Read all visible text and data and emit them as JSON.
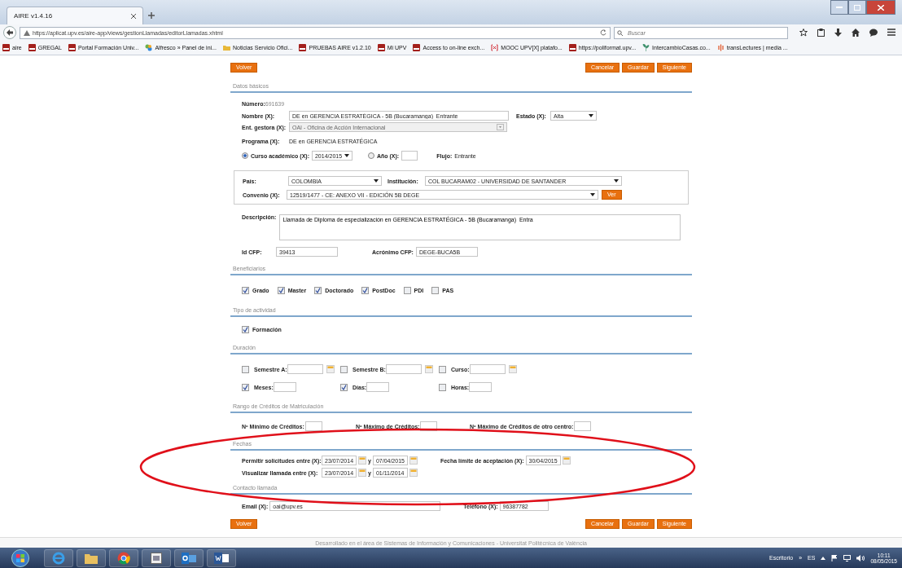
{
  "browser": {
    "tab_title": "AIRE v1.4.16",
    "url": "https://aplicat.upv.es/aire-app/views/gestionLlamadas/editorLlamadas.xhtml",
    "search_placeholder": "Buscar",
    "bookmarks": [
      {
        "kind": "upv",
        "label": "aire"
      },
      {
        "kind": "upv",
        "label": "GREGAL"
      },
      {
        "kind": "upv",
        "label": "Portal Formación Univ..."
      },
      {
        "kind": "alfresco",
        "label": "Alfresco » Panel de ini..."
      },
      {
        "kind": "folder",
        "label": "Noticias Servicio Ofici..."
      },
      {
        "kind": "upv",
        "label": "PRUEBAS AIRE v1.2.10"
      },
      {
        "kind": "upv",
        "label": "Mi UPV"
      },
      {
        "kind": "upv",
        "label": "Access to on-line exch..."
      },
      {
        "kind": "mooc",
        "label": "MOOC UPV[X] platafo..."
      },
      {
        "kind": "upv",
        "label": "https://poliformat.upv..."
      },
      {
        "kind": "plant",
        "label": "IntercambioCasas.co..."
      },
      {
        "kind": "translectures",
        "label": "transLectures | media ..."
      }
    ]
  },
  "actions": {
    "back": "Volver",
    "buttons": [
      "Cancelar",
      "Guardar",
      "Siguiente"
    ]
  },
  "datos_basicos": {
    "heading": "Datos básicos",
    "numero": {
      "label": "Número:",
      "value": "691639"
    },
    "nombre": {
      "label": "Nombre (X):",
      "value": "DE en GERENCIA ESTRATÉGICA - 5B (Bucaramanga)  Entrante"
    },
    "estado": {
      "label": "Estado (X):",
      "value": "Alta"
    },
    "entidad": {
      "label": "Ent. gestora (X):",
      "value": "OAI - Oficina de Acción Internacional",
      "disabled": true
    },
    "programa": {
      "label": "Programa (X):",
      "value": "DE en GERENCIA ESTRATÉGICA"
    },
    "periodo": [
      {
        "kind": "select",
        "label": "Curso académico (X):",
        "value": "2014/2015",
        "selected": true
      },
      {
        "kind": "input",
        "label": "Año (X):",
        "selected": false
      }
    ],
    "flujo": {
      "label": "Flujo:",
      "value": "Entrante"
    },
    "pais": {
      "label": "País:",
      "value": "COLOMBIA"
    },
    "institucion": {
      "label": "Institución:",
      "value": "COL BUCARAM02 - UNIVERSIDAD DE SANTANDER"
    },
    "convenio": {
      "label": "Convenio (X):",
      "value": "12519/1477 - CE: ANEXO VII - EDICIÓN 5B DEGE"
    },
    "ver_button": "Ver",
    "descripcion": {
      "label": "Descripción:",
      "value": "Llamada de Diploma de especialización en GERENCIA ESTRATÉGICA - 5B (Bucaramanga)  Entra"
    },
    "id_cfp": {
      "label": "Id CFP:",
      "value": "39413"
    },
    "acronimo": {
      "label": "Acrónimo CFP:",
      "value": "DEGE-BUCA5B"
    }
  },
  "beneficiarios": {
    "heading": "Beneficiarios",
    "items": [
      {
        "label": "Grado",
        "checked": true
      },
      {
        "label": "Master",
        "checked": true
      },
      {
        "label": "Doctorado",
        "checked": true
      },
      {
        "label": "PostDoc",
        "checked": true
      },
      {
        "label": "PDI",
        "checked": false
      },
      {
        "label": "PAS",
        "checked": false
      }
    ]
  },
  "tipo_actividad": {
    "heading": "Tipo de actividad",
    "items": [
      {
        "label": "Formación",
        "checked": true
      }
    ]
  },
  "duracion": {
    "heading": "Duración",
    "rows": [
      [
        {
          "kind": "date",
          "label": "Semestre A:",
          "checked": false
        },
        {
          "kind": "date",
          "label": "Semestre B:",
          "checked": false
        },
        {
          "kind": "date",
          "label": "Curso:",
          "checked": false
        }
      ],
      [
        {
          "kind": "number",
          "label": "Meses:",
          "checked": true
        },
        {
          "kind": "number",
          "label": "Días:",
          "checked": true
        },
        {
          "kind": "number",
          "label": "Horas:",
          "checked": false
        }
      ]
    ]
  },
  "rango_creditos": {
    "heading": "Rango de Créditos de Matriculación",
    "fields": [
      {
        "label": "Nº Mínimo de Créditos:"
      },
      {
        "label": "Nº Máximo de Créditos:"
      },
      {
        "label": "Nº Máximo de Créditos de otro centro:"
      }
    ]
  },
  "fechas": {
    "heading": "Fechas",
    "ranges": [
      {
        "label": "Permitir solicitudes entre (X):",
        "from": "23/07/2014",
        "joiner": "y",
        "to": "07/04/2015"
      },
      {
        "label": "Visualizar llamada entre (X):",
        "from": "23/07/2014",
        "joiner": "y",
        "to": "01/11/2014"
      }
    ],
    "deadline": {
      "label": "Fecha límite de aceptación (X):",
      "value": "30/04/2015"
    }
  },
  "contacto": {
    "heading": "Contacto llamada",
    "email": {
      "label": "Email (X):",
      "value": "oai@upv.es"
    },
    "telefono": {
      "label": "Teléfono (X):",
      "value": "96387782"
    }
  },
  "bottom_actions": {
    "back": "Volver",
    "buttons": [
      "Cancelar",
      "Guardar",
      "Siguiente"
    ]
  },
  "footer": "Desarrollado en el área de Sistemas de Información y Comunicaciones - Universitat Politècnica de València",
  "taskbar": {
    "desktop": "Escritorio",
    "chevron": "»",
    "language": "ES",
    "time": "10:11",
    "date": "08/05/2015"
  }
}
